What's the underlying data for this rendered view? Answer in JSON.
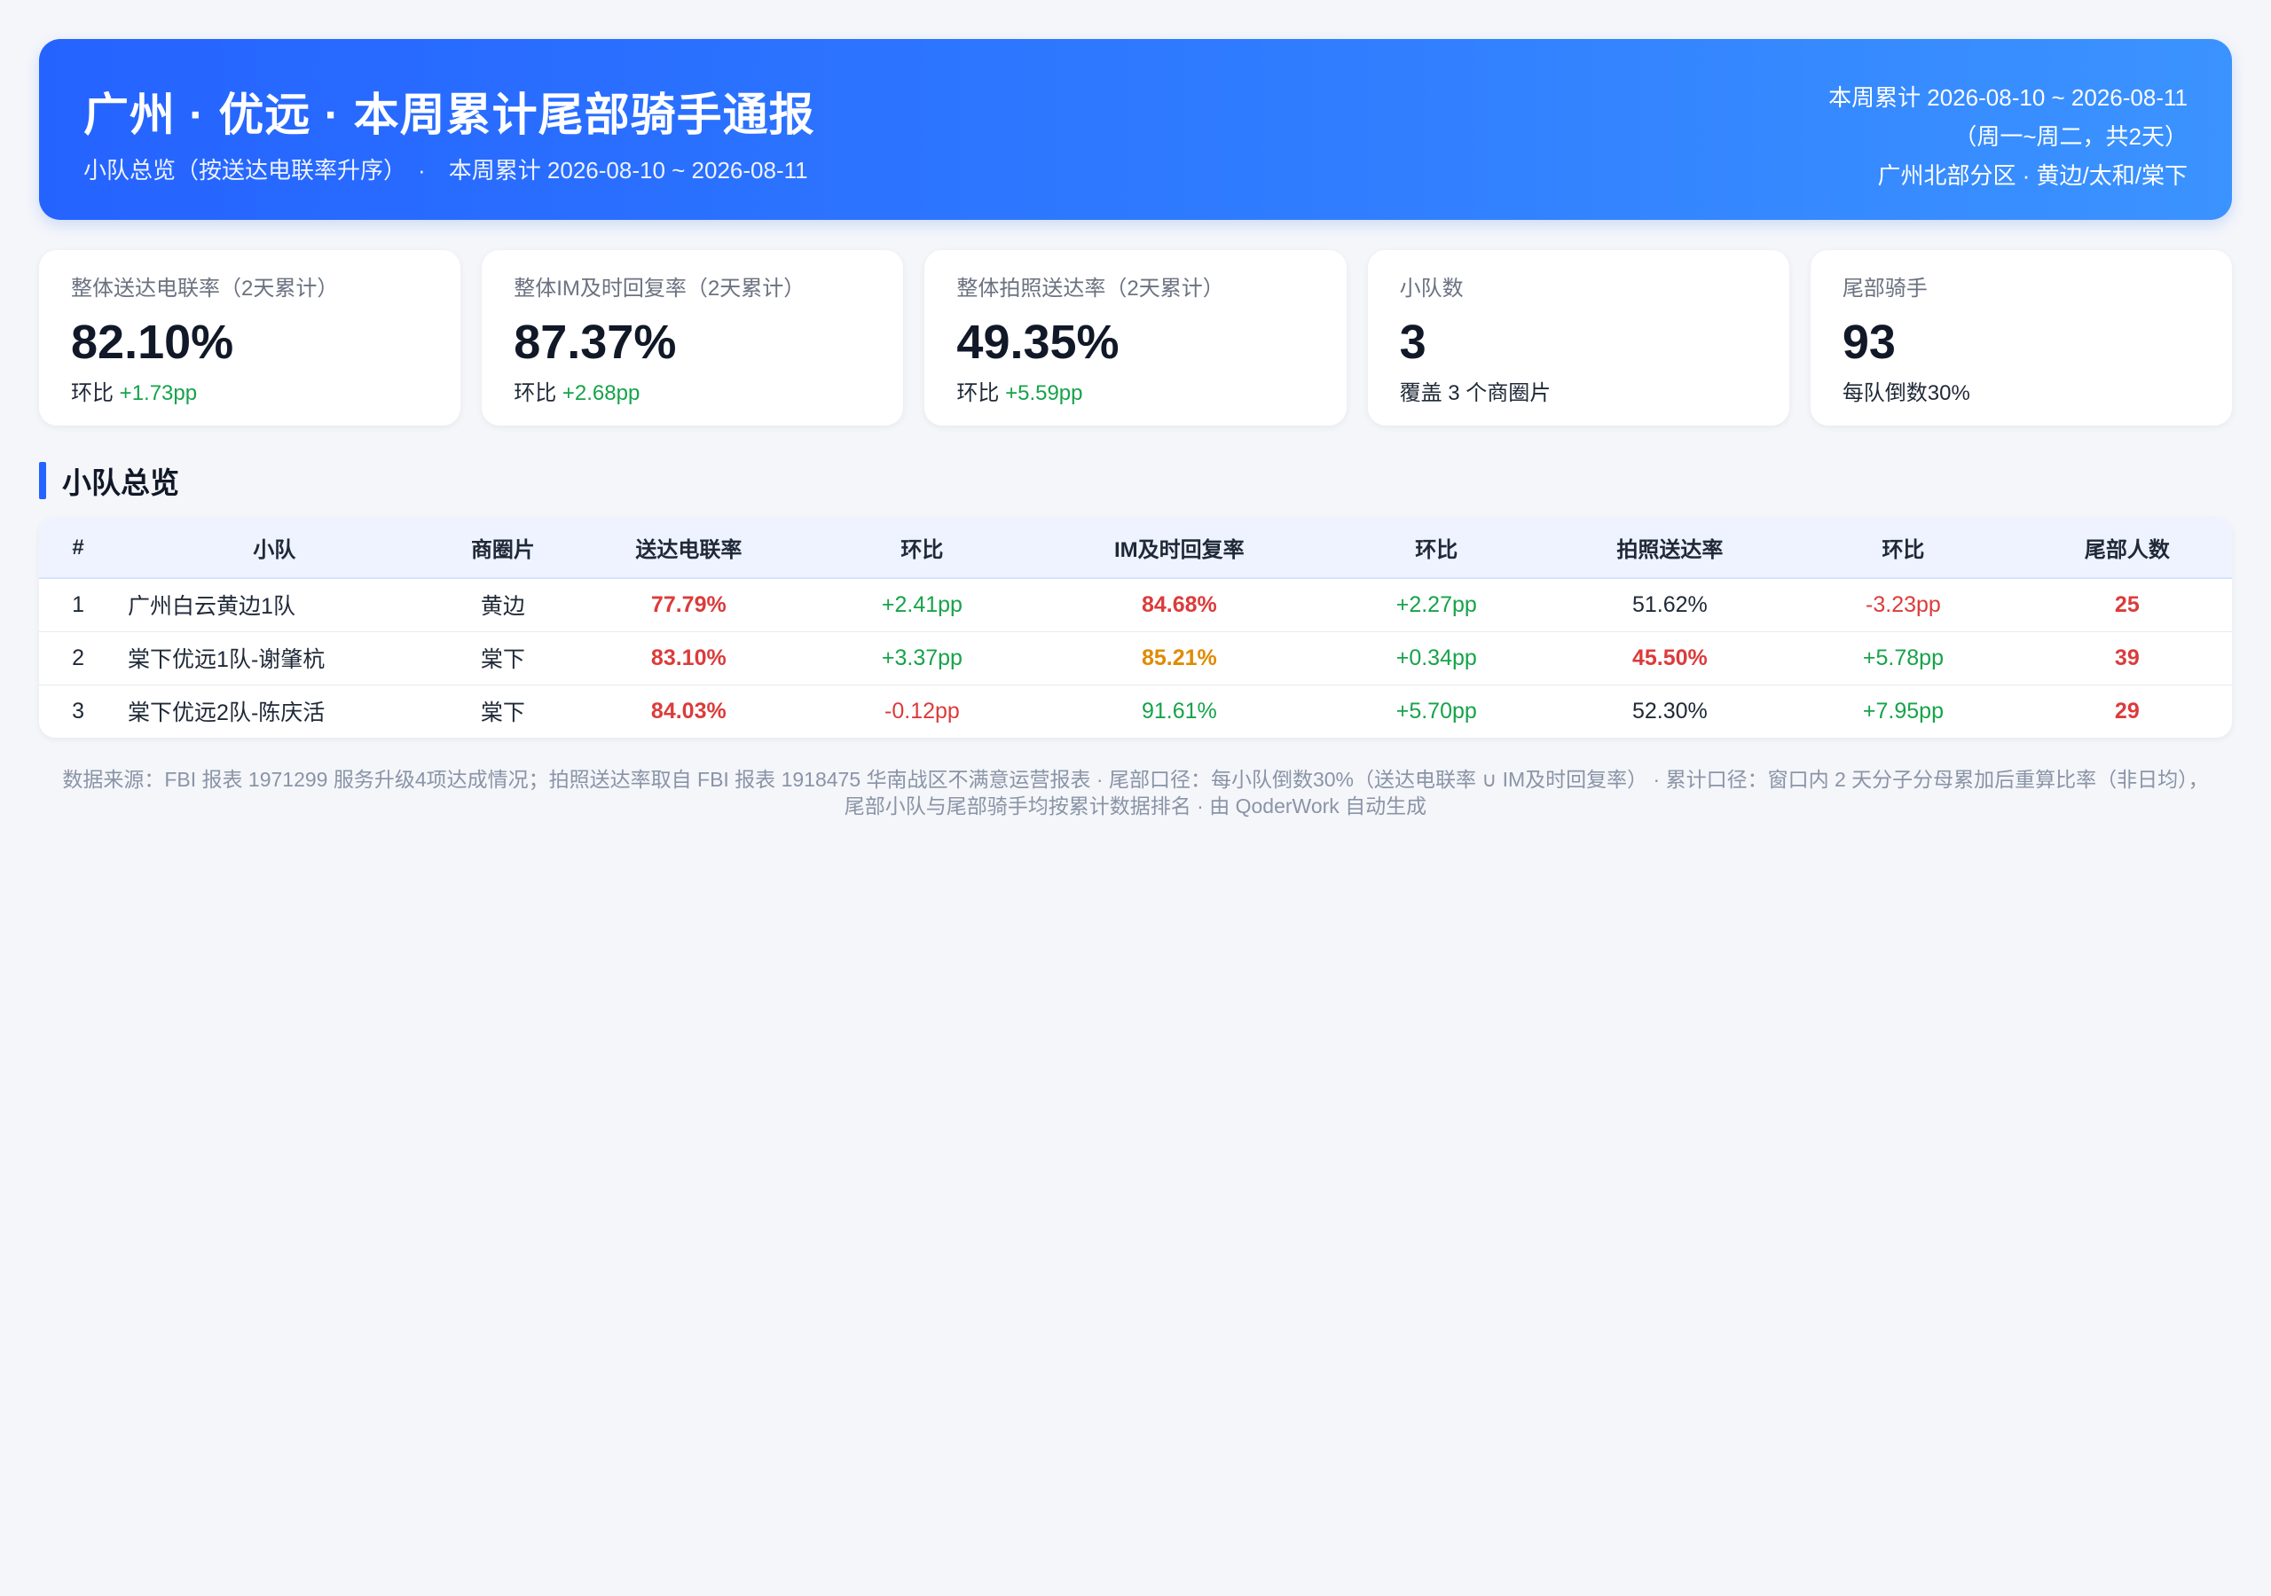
{
  "header": {
    "title": "广州 · 优远 · 本周累计尾部骑手通报",
    "subtitle_left": "小队总览（按送达电联率升序）",
    "subtitle_sep": "·",
    "subtitle_right": "本周累计 2026-08-10 ~ 2026-08-11",
    "right_line1": "本周累计 2026-08-10 ~ 2026-08-11",
    "right_line2": "（周一~周二，共2天）",
    "right_line3": "广州北部分区 · 黄边/太和/棠下"
  },
  "kpis": [
    {
      "label": "整体送达电联率（2天累计）",
      "value": "82.10%",
      "note_prefix": "环比 ",
      "note_delta": "+1.73pp"
    },
    {
      "label": "整体IM及时回复率（2天累计）",
      "value": "87.37%",
      "note_prefix": "环比 ",
      "note_delta": "+2.68pp"
    },
    {
      "label": "整体拍照送达率（2天累计）",
      "value": "49.35%",
      "note_prefix": "环比 ",
      "note_delta": "+5.59pp"
    },
    {
      "label": "小队数",
      "value": "3",
      "note_prefix": "覆盖 3 个商圈片",
      "note_delta": ""
    },
    {
      "label": "尾部骑手",
      "value": "93",
      "note_prefix": "每队倒数30%",
      "note_delta": ""
    }
  ],
  "section": {
    "title": "小队总览"
  },
  "table": {
    "headers": [
      "#",
      "小队",
      "商圈片",
      "送达电联率",
      "环比",
      "IM及时回复率",
      "环比",
      "拍照送达率",
      "环比",
      "尾部人数"
    ],
    "rows": [
      {
        "idx": "1",
        "team": "广州白云黄边1队",
        "area": "黄边",
        "call_rate": "77.79%",
        "call_delta": "+2.41pp",
        "im_rate": "84.68%",
        "im_delta": "+2.27pp",
        "photo_rate": "51.62%",
        "photo_delta": "-3.23pp",
        "tail": "25"
      },
      {
        "idx": "2",
        "team": "棠下优远1队-谢肇杭",
        "area": "棠下",
        "call_rate": "83.10%",
        "call_delta": "+3.37pp",
        "im_rate": "85.21%",
        "im_delta": "+0.34pp",
        "photo_rate": "45.50%",
        "photo_delta": "+5.78pp",
        "tail": "39"
      },
      {
        "idx": "3",
        "team": "棠下优远2队-陈庆活",
        "area": "棠下",
        "call_rate": "84.03%",
        "call_delta": "-0.12pp",
        "im_rate": "91.61%",
        "im_delta": "+5.70pp",
        "photo_rate": "52.30%",
        "photo_delta": "+7.95pp",
        "tail": "29"
      }
    ]
  },
  "footer": {
    "line1": "数据来源：FBI 报表 1971299 服务升级4项达成情况；拍照送达率取自 FBI 报表 1918475 华南战区不满意运营报表 · 尾部口径：每小队倒数30%（送达电联率 ∪ IM及时回复率）  ·  累计口径：窗口内 2 天分子分母累加后重算比率（非日均），",
    "line2": "尾部小队与尾部骑手均按累计数据排名 · 由 QoderWork 自动生成"
  },
  "colors": {
    "accent": "#2563ff",
    "positive": "#16a34a",
    "negative": "#dc3b3b",
    "warning": "#e08a00"
  }
}
